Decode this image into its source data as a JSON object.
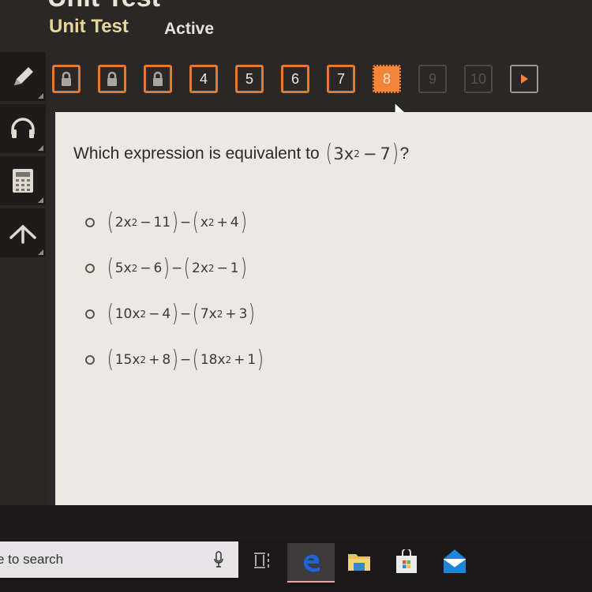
{
  "header": {
    "title": "Unit Test",
    "course": "Unit Test",
    "status": "Active"
  },
  "tools": [
    {
      "name": "pencil",
      "icon": "pencil-icon"
    },
    {
      "name": "audio",
      "icon": "headphones-icon"
    },
    {
      "name": "calculator",
      "icon": "calculator-icon"
    },
    {
      "name": "reference",
      "icon": "compass-icon"
    }
  ],
  "question_nav": {
    "items": [
      {
        "label": "",
        "state": "locked"
      },
      {
        "label": "",
        "state": "locked"
      },
      {
        "label": "",
        "state": "locked"
      },
      {
        "label": "4",
        "state": "available"
      },
      {
        "label": "5",
        "state": "available"
      },
      {
        "label": "6",
        "state": "available"
      },
      {
        "label": "7",
        "state": "available"
      },
      {
        "label": "8",
        "state": "current"
      },
      {
        "label": "9",
        "state": "disabled"
      },
      {
        "label": "10",
        "state": "disabled"
      }
    ],
    "next_icon": "play-arrow-icon"
  },
  "question": {
    "prompt": "Which expression is equivalent to",
    "expression": {
      "a": "3x",
      "b": "7",
      "op": "−"
    },
    "end": "?"
  },
  "options": [
    {
      "left": {
        "a": "2x",
        "op": "−",
        "b": "11"
      },
      "right": {
        "a": "x",
        "op": "+",
        "b": "4"
      }
    },
    {
      "left": {
        "a": "5x",
        "op": "−",
        "b": "6"
      },
      "right": {
        "a": "2x",
        "op": "−",
        "b": "1"
      }
    },
    {
      "left": {
        "a": "10x",
        "op": "−",
        "b": "4"
      },
      "right": {
        "a": "7x",
        "op": "+",
        "b": "3"
      }
    },
    {
      "left": {
        "a": "15x",
        "op": "+",
        "b": "8"
      },
      "right": {
        "a": "18x",
        "op": "+",
        "b": "1"
      }
    }
  ],
  "exponent": "2",
  "minus_sign": "−",
  "taskbar": {
    "search_placeholder": "e to search"
  },
  "colors": {
    "accent": "#f2853a",
    "nav_border": "#e07a33",
    "panel_bg": "#ece9e3"
  }
}
